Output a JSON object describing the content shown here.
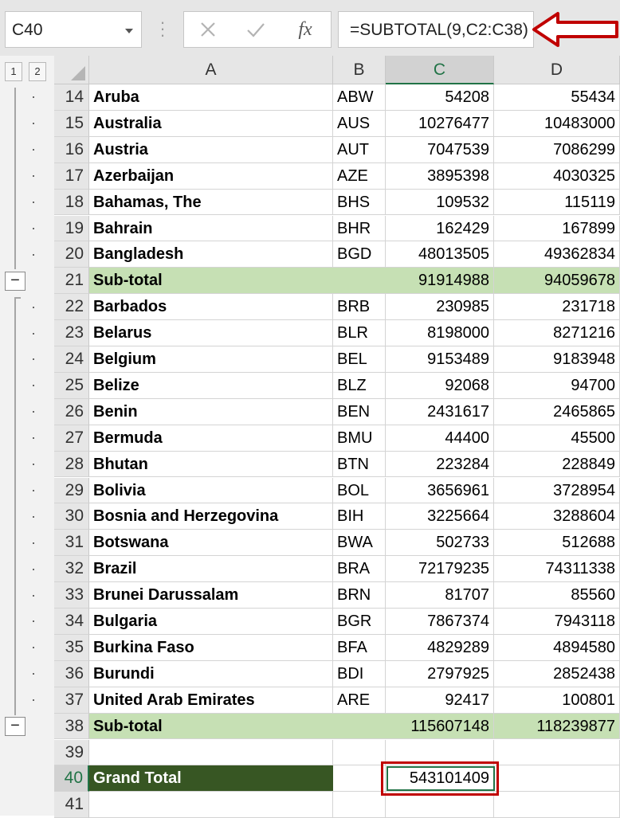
{
  "name_box": {
    "value": "C40"
  },
  "formula_bar": {
    "cancel_icon": "cross-icon",
    "enter_icon": "check-icon",
    "function_label": "fx",
    "formula": "=SUBTOTAL(9,C2:C38)"
  },
  "outline": {
    "level_buttons": [
      "1",
      "2"
    ],
    "collapse_label": "−"
  },
  "columns": [
    "A",
    "B",
    "C",
    "D"
  ],
  "active_column": "C",
  "active_row": "40",
  "rows": [
    {
      "row": "14",
      "name": "Aruba",
      "code": "ABW",
      "c": "54208",
      "d": "55434",
      "kind": "data"
    },
    {
      "row": "15",
      "name": "Australia",
      "code": "AUS",
      "c": "10276477",
      "d": "10483000",
      "kind": "data"
    },
    {
      "row": "16",
      "name": "Austria",
      "code": "AUT",
      "c": "7047539",
      "d": "7086299",
      "kind": "data"
    },
    {
      "row": "17",
      "name": "Azerbaijan",
      "code": "AZE",
      "c": "3895398",
      "d": "4030325",
      "kind": "data"
    },
    {
      "row": "18",
      "name": "Bahamas, The",
      "code": "BHS",
      "c": "109532",
      "d": "115119",
      "kind": "data"
    },
    {
      "row": "19",
      "name": "Bahrain",
      "code": "BHR",
      "c": "162429",
      "d": "167899",
      "kind": "data"
    },
    {
      "row": "20",
      "name": "Bangladesh",
      "code": "BGD",
      "c": "48013505",
      "d": "49362834",
      "kind": "data"
    },
    {
      "row": "21",
      "name": "Sub-total",
      "code": "",
      "c": "91914988",
      "d": "94059678",
      "kind": "subtotal"
    },
    {
      "row": "22",
      "name": "Barbados",
      "code": "BRB",
      "c": "230985",
      "d": "231718",
      "kind": "data"
    },
    {
      "row": "23",
      "name": "Belarus",
      "code": "BLR",
      "c": "8198000",
      "d": "8271216",
      "kind": "data"
    },
    {
      "row": "24",
      "name": "Belgium",
      "code": "BEL",
      "c": "9153489",
      "d": "9183948",
      "kind": "data"
    },
    {
      "row": "25",
      "name": "Belize",
      "code": "BLZ",
      "c": "92068",
      "d": "94700",
      "kind": "data"
    },
    {
      "row": "26",
      "name": "Benin",
      "code": "BEN",
      "c": "2431617",
      "d": "2465865",
      "kind": "data"
    },
    {
      "row": "27",
      "name": "Bermuda",
      "code": "BMU",
      "c": "44400",
      "d": "45500",
      "kind": "data"
    },
    {
      "row": "28",
      "name": "Bhutan",
      "code": "BTN",
      "c": "223284",
      "d": "228849",
      "kind": "data"
    },
    {
      "row": "29",
      "name": "Bolivia",
      "code": "BOL",
      "c": "3656961",
      "d": "3728954",
      "kind": "data"
    },
    {
      "row": "30",
      "name": "Bosnia and Herzegovina",
      "code": "BIH",
      "c": "3225664",
      "d": "3288604",
      "kind": "data"
    },
    {
      "row": "31",
      "name": "Botswana",
      "code": "BWA",
      "c": "502733",
      "d": "512688",
      "kind": "data"
    },
    {
      "row": "32",
      "name": "Brazil",
      "code": "BRA",
      "c": "72179235",
      "d": "74311338",
      "kind": "data"
    },
    {
      "row": "33",
      "name": "Brunei Darussalam",
      "code": "BRN",
      "c": "81707",
      "d": "85560",
      "kind": "data"
    },
    {
      "row": "34",
      "name": "Bulgaria",
      "code": "BGR",
      "c": "7867374",
      "d": "7943118",
      "kind": "data"
    },
    {
      "row": "35",
      "name": "Burkina Faso",
      "code": "BFA",
      "c": "4829289",
      "d": "4894580",
      "kind": "data"
    },
    {
      "row": "36",
      "name": "Burundi",
      "code": "BDI",
      "c": "2797925",
      "d": "2852438",
      "kind": "data"
    },
    {
      "row": "37",
      "name": "United Arab Emirates",
      "code": "ARE",
      "c": "92417",
      "d": "100801",
      "kind": "data"
    },
    {
      "row": "38",
      "name": "Sub-total",
      "code": "",
      "c": "115607148",
      "d": "118239877",
      "kind": "subtotal"
    },
    {
      "row": "39",
      "name": "",
      "code": "",
      "c": "",
      "d": "",
      "kind": "empty"
    },
    {
      "row": "40",
      "name": "Grand Total",
      "code": "",
      "c": "543101409",
      "d": "",
      "kind": "grand"
    },
    {
      "row": "41",
      "name": "",
      "code": "",
      "c": "",
      "d": "",
      "kind": "empty"
    }
  ],
  "colors": {
    "subtotal_fill": "#c6e0b4",
    "grand_total_fill": "#375623",
    "highlight_red": "#c00000",
    "excel_green": "#217346"
  }
}
